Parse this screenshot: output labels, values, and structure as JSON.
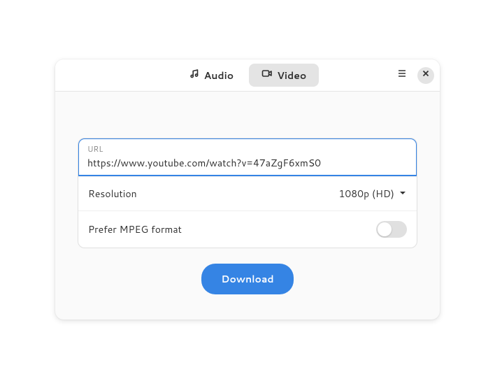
{
  "header": {
    "tabs": {
      "audio": "Audio",
      "video": "Video"
    }
  },
  "url_field": {
    "label": "URL",
    "value": "https://www.youtube.com/watch?v=47aZgF6xmS0"
  },
  "resolution": {
    "label": "Resolution",
    "value": "1080p (HD)"
  },
  "prefer_mpeg": {
    "label": "Prefer MPEG format",
    "enabled": false
  },
  "download_button": "Download",
  "colors": {
    "accent": "#3584e4"
  }
}
